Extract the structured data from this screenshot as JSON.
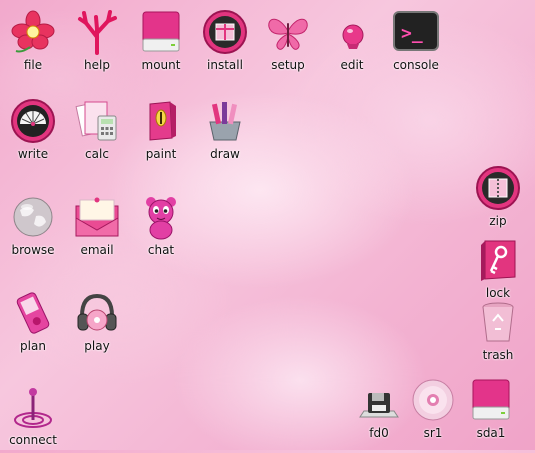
{
  "desktop": {
    "icons": [
      {
        "label": "file"
      },
      {
        "label": "help"
      },
      {
        "label": "mount"
      },
      {
        "label": "install"
      },
      {
        "label": "setup"
      },
      {
        "label": "edit"
      },
      {
        "label": "console"
      },
      {
        "label": "write"
      },
      {
        "label": "calc"
      },
      {
        "label": "paint"
      },
      {
        "label": "draw"
      },
      {
        "label": "browse"
      },
      {
        "label": "email"
      },
      {
        "label": "chat"
      },
      {
        "label": "plan"
      },
      {
        "label": "play"
      },
      {
        "label": "connect"
      },
      {
        "label": "zip"
      },
      {
        "label": "lock"
      },
      {
        "label": "trash"
      },
      {
        "label": "fd0"
      },
      {
        "label": "sr1"
      },
      {
        "label": "sda1"
      }
    ],
    "console_prompt": ">_",
    "accent_color": "#e2357f"
  }
}
